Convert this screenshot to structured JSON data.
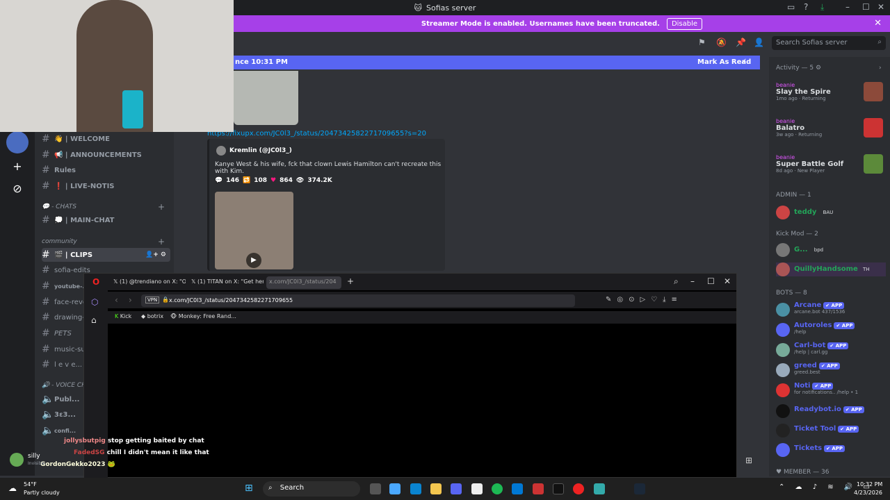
{
  "window": {
    "title": "Sofias server"
  },
  "banner": {
    "text": "Streamer Mode is enabled. Usernames have been truncated.",
    "disable_label": "Disable"
  },
  "new_messages": {
    "since": "nce 10:31 PM",
    "mark_read": "Mark As Read"
  },
  "search": {
    "placeholder": "Search Sofias server"
  },
  "channels": [
    {
      "label": "👋 | WELCOME",
      "type": "text"
    },
    {
      "label": "📢 | ANNOUNCEMENTS",
      "type": "text"
    },
    {
      "label": "Rules",
      "type": "text"
    },
    {
      "label": "❗ | LIVE-NOTIS",
      "type": "text"
    },
    {
      "label": "💬 - CHATS",
      "type": "category"
    },
    {
      "label": "💭 | MAIN-CHAT",
      "type": "text"
    },
    {
      "label": "community",
      "type": "category"
    },
    {
      "label": "🎬 | CLIPS",
      "type": "text"
    },
    {
      "label": "sofia-edits",
      "type": "text"
    },
    {
      "label": "youtube-...",
      "type": "text"
    },
    {
      "label": "face-reve...",
      "type": "text"
    },
    {
      "label": "drawing-...",
      "type": "text"
    },
    {
      "label": "PETS",
      "type": "text"
    },
    {
      "label": "music-su...",
      "type": "text"
    },
    {
      "label": "l e v e...",
      "type": "text"
    },
    {
      "label": "🔊 - VOICE CH...",
      "type": "category"
    },
    {
      "label": "Publ...",
      "type": "voice"
    },
    {
      "label": "3ε3...",
      "type": "voice"
    },
    {
      "label": "confi...",
      "type": "voice"
    }
  ],
  "message": {
    "link": "https://fixupx.com/JC0l3_/status/2047342582271709655?s=20",
    "embed_author": "Kremlin (@JC0l3_)",
    "embed_text": "Kanye West & his wife, fck that clown Lewis Hamilton can't recreate this with Kim.",
    "stats": {
      "replies": "146",
      "reposts": "108",
      "likes": "864",
      "views": "374.2K"
    }
  },
  "members": {
    "activity_header": "Activity — 5",
    "activity": [
      {
        "name": "beanie",
        "game": "Slay the Spire",
        "meta": "1mo ago · Returning"
      },
      {
        "name": "beanie",
        "game": "Balatro",
        "meta": "3w ago · Returning"
      },
      {
        "name": "beanie",
        "game": "Super Battle Golf",
        "meta": "8d ago · New Player"
      }
    ],
    "admin_header": "ADMIN — 1",
    "admin": [
      {
        "name": "teddy",
        "tag": "BAU"
      }
    ],
    "kickmod_header": "Kick Mod — 2",
    "kickmod": [
      {
        "name": "G...",
        "tag": "bpd"
      },
      {
        "name": "QuillyHandsome",
        "tag": "TH"
      }
    ],
    "bots_header": "BOTS — 8",
    "bots": [
      {
        "name": "Arcane",
        "sub": "arcane.bot 437/1536"
      },
      {
        "name": "Autoroles",
        "sub": "/help"
      },
      {
        "name": "Carl-bot",
        "sub": "/help | carl.gg"
      },
      {
        "name": "greed",
        "sub": "greed.best"
      },
      {
        "name": "Noti",
        "sub": "for notifications.. /help • 1"
      },
      {
        "name": "Readybot.io",
        "sub": ""
      },
      {
        "name": "Ticket Tool",
        "sub": ""
      },
      {
        "name": "Tickets",
        "sub": ""
      }
    ],
    "app_badge": "✔ APP",
    "member_header": "MEMBER — 36"
  },
  "browser": {
    "tabs": [
      "(1) @trendiano on X: \"OM",
      "(1) TITAN on X: \"Get her i",
      "x.com/JC0l3_/status/204"
    ],
    "vpn": "VPN",
    "url": "x.com/JC0l3_/status/2047342582271709655",
    "bookmarks": [
      "Kick",
      "botrix",
      "Monkey: Free Rand..."
    ]
  },
  "stream_chat": [
    {
      "user": "jollysbutpig",
      "text": "stop getting baited by chat"
    },
    {
      "user": "FadedSG",
      "text": "chill I didn't mean it like that"
    },
    {
      "user": "GordonGekko2023",
      "text": ""
    }
  ],
  "user_panel": {
    "name": "silly",
    "status": "Invisible"
  },
  "taskbar": {
    "weather_temp": "54°F",
    "weather_desc": "Partly cloudy",
    "search": "Search",
    "time": "10:32 PM",
    "date": "4/23/2026"
  }
}
